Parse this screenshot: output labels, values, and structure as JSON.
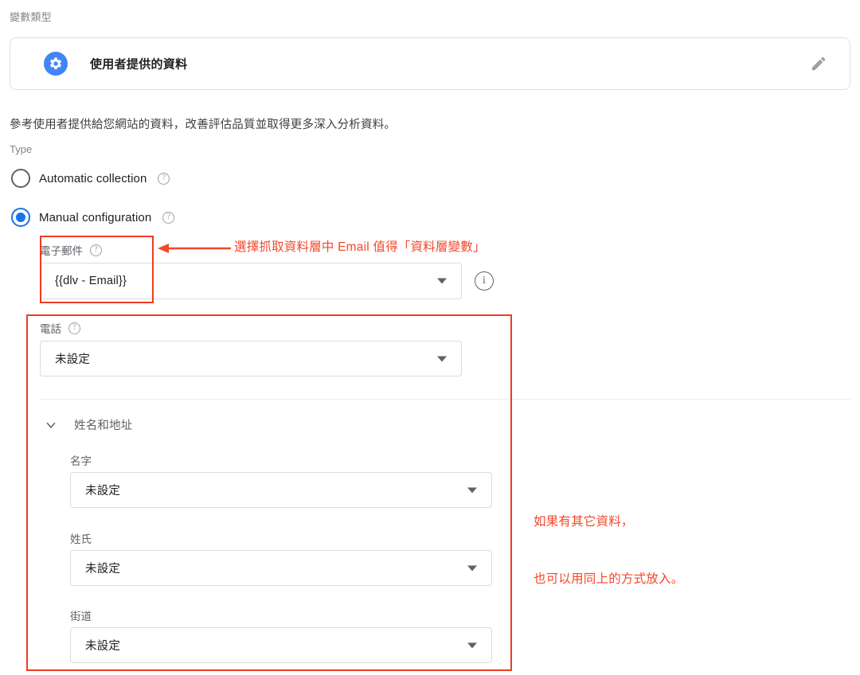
{
  "header": {
    "variable_type_label": "變數類型",
    "card_title": "使用者提供的資料",
    "gear_icon": "gear-icon",
    "edit_icon": "pencil-icon"
  },
  "description": "參考使用者提供給您網站的資料，改善評估品質並取得更多深入分析資料。",
  "type_section": {
    "label": "Type",
    "options": [
      {
        "label": "Automatic collection",
        "selected": false,
        "help": "?"
      },
      {
        "label": "Manual configuration",
        "selected": true,
        "help": "?"
      }
    ]
  },
  "fields": {
    "email": {
      "label": "電子郵件",
      "help": "?",
      "value": "{{dlv - Email}}",
      "info_icon": "info-icon"
    },
    "phone": {
      "label": "電話",
      "help": "?",
      "value": "未設定"
    }
  },
  "name_address_section": {
    "title": "姓名和地址",
    "expanded": true,
    "chevron_icon": "chevron-down-icon",
    "fields": [
      {
        "label": "名字",
        "value": "未設定"
      },
      {
        "label": "姓氏",
        "value": "未設定"
      },
      {
        "label": "街道",
        "value": "未設定"
      }
    ]
  },
  "annotations": {
    "accent_color": "#f4472a",
    "email_note": "選擇抓取資料層中 Email 值得「資料層變數」",
    "other_note_line1": "如果有其它資料，",
    "other_note_line2": "也可以用同上的方式放入。"
  },
  "colors": {
    "blue": "#4285f4",
    "radio_blue": "#1a73e8",
    "border": "#dadce0",
    "text": "#202124",
    "muted": "#5f6368",
    "red": "#ef3b23"
  }
}
